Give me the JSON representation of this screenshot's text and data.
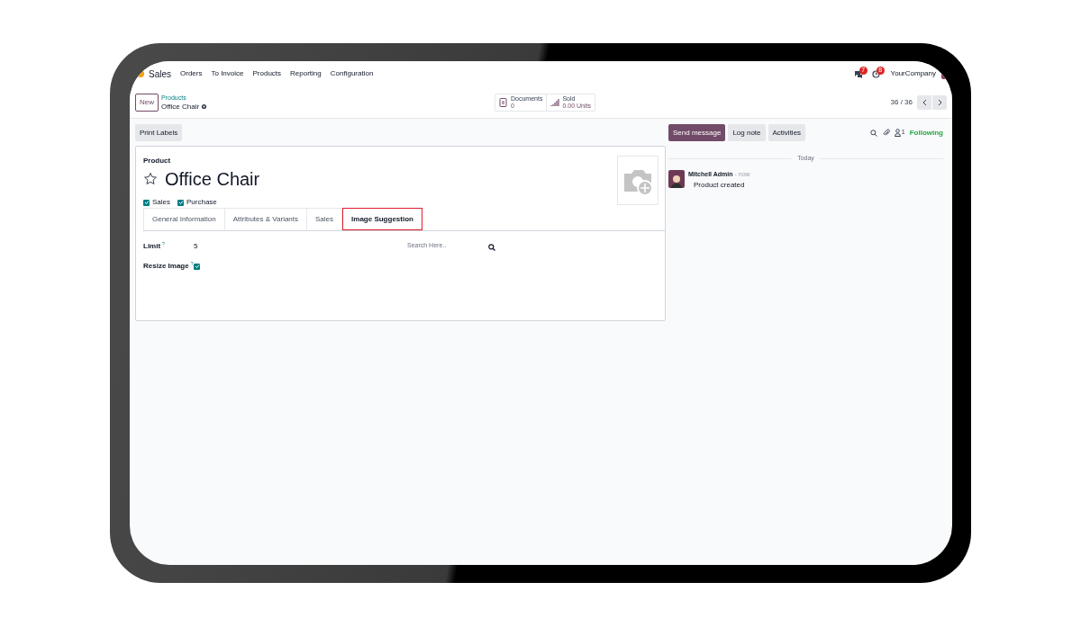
{
  "navbar": {
    "app": "Sales",
    "menu": [
      "Orders",
      "To Invoice",
      "Products",
      "Reporting",
      "Configuration"
    ],
    "messages_badge": "7",
    "activities_badge": "8",
    "company": "YourCompany"
  },
  "control_panel": {
    "new_button": "New",
    "breadcrumb": "Products",
    "record": "Office Chair",
    "stats": [
      {
        "kind": "documents",
        "label": "Documents",
        "value": "0"
      },
      {
        "kind": "sold",
        "label": "Sold",
        "value": "0.00 Units"
      }
    ],
    "pager": "36 / 36"
  },
  "actions": [
    "Print Labels"
  ],
  "form": {
    "label": "Product",
    "name": "Office Chair",
    "starred": false,
    "options": [
      {
        "label": "Sales",
        "checked": true
      },
      {
        "label": "Purchase",
        "checked": true
      }
    ],
    "tabs": [
      {
        "label": "General Information",
        "selected": false,
        "highlighted": false
      },
      {
        "label": "Attributes & Variants",
        "selected": false,
        "highlighted": false
      },
      {
        "label": "Sales",
        "selected": false,
        "highlighted": false
      },
      {
        "label": "Image Suggestion",
        "selected": true,
        "highlighted": true
      }
    ],
    "fields": [
      {
        "kind": "text",
        "label": "Limit",
        "help": "?",
        "value": "5"
      },
      {
        "kind": "checkbox",
        "label": "Resize Image",
        "help": "?",
        "checked": true
      }
    ],
    "search": {
      "placeholder": "Search Here.."
    }
  },
  "chatter": {
    "buttons": [
      {
        "label": "Send message",
        "selected": true
      },
      {
        "label": "Log note",
        "selected": false
      },
      {
        "label": "Activities",
        "selected": false
      }
    ],
    "followers": "1",
    "follow_state": "Following",
    "divider": "Today",
    "messages": [
      {
        "author": "Mitchell Admin",
        "time": "- now",
        "body": "Product created"
      }
    ]
  }
}
